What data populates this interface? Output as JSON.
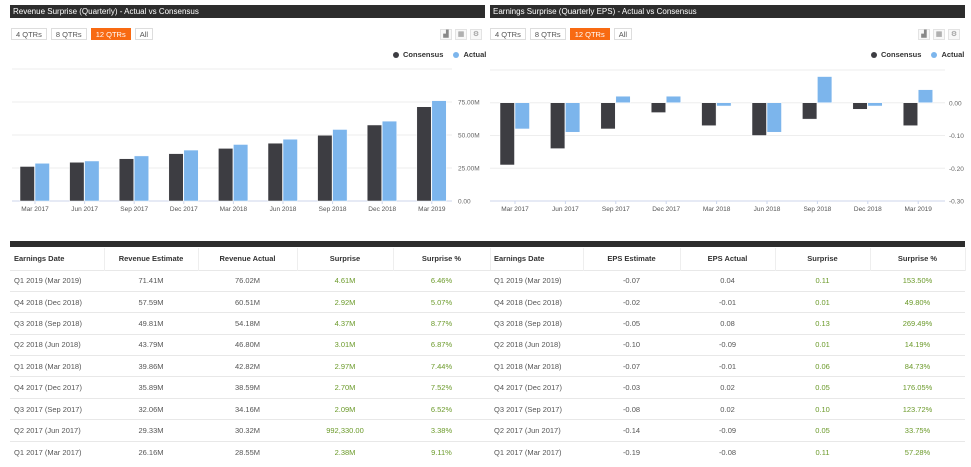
{
  "range_buttons": [
    "4 QTRs",
    "8 QTRs",
    "12 QTRs",
    "All"
  ],
  "active_range": "12 QTRs",
  "colors": {
    "consensus": "#3d3d42",
    "actual": "#7cb5ec",
    "accent": "#f86a12",
    "positive": "#6b9a2a"
  },
  "legend": {
    "consensus": "Consensus",
    "actual": "Actual"
  },
  "tools": [
    "chart-icon",
    "table-icon",
    "gear-icon"
  ],
  "chart_data": [
    {
      "type": "bar",
      "title": "Revenue Surprise (Quarterly) - Actual vs Consensus",
      "categories": [
        "Mar 2017",
        "Jun 2017",
        "Sep 2017",
        "Dec 2017",
        "Mar 2018",
        "Jun 2018",
        "Sep 2018",
        "Dec 2018",
        "Mar 2019"
      ],
      "series": [
        {
          "name": "Consensus",
          "values": [
            26.16,
            29.33,
            32.06,
            35.89,
            39.86,
            43.79,
            49.81,
            57.59,
            71.41
          ]
        },
        {
          "name": "Actual",
          "values": [
            28.55,
            30.32,
            34.16,
            38.59,
            42.82,
            46.8,
            54.18,
            60.51,
            76.02
          ]
        }
      ],
      "yticks": [
        "0.00",
        "25.00M",
        "50.00M",
        "75.00M"
      ],
      "ytick_values": [
        0,
        25,
        50,
        75
      ],
      "ylim": [
        0,
        100
      ],
      "yunit": "M"
    },
    {
      "type": "bar",
      "title": "Earnings Surprise (Quarterly EPS) - Actual vs Consensus",
      "categories": [
        "Mar 2017",
        "Jun 2017",
        "Sep 2017",
        "Dec 2017",
        "Mar 2018",
        "Jun 2018",
        "Sep 2018",
        "Dec 2018",
        "Mar 2019"
      ],
      "series": [
        {
          "name": "Consensus",
          "values": [
            -0.19,
            -0.14,
            -0.08,
            -0.03,
            -0.07,
            -0.1,
            -0.05,
            -0.02,
            -0.07
          ]
        },
        {
          "name": "Actual",
          "values": [
            -0.08,
            -0.09,
            0.02,
            0.02,
            -0.01,
            -0.09,
            0.08,
            -0.01,
            0.04
          ]
        }
      ],
      "yticks": [
        "0.00",
        "-0.10",
        "-0.20",
        "-0.30"
      ],
      "ytick_values": [
        0,
        -0.1,
        -0.2,
        -0.3
      ],
      "ylim": [
        -0.3,
        0.1
      ]
    }
  ],
  "revenue_table": {
    "headers": [
      "Earnings Date",
      "Revenue Estimate",
      "Revenue Actual",
      "Surprise",
      "Surprise %"
    ],
    "rows": [
      [
        "Q1 2019 (Mar 2019)",
        "71.41M",
        "76.02M",
        "4.61M",
        "6.46%"
      ],
      [
        "Q4 2018 (Dec 2018)",
        "57.59M",
        "60.51M",
        "2.92M",
        "5.07%"
      ],
      [
        "Q3 2018 (Sep 2018)",
        "49.81M",
        "54.18M",
        "4.37M",
        "8.77%"
      ],
      [
        "Q2 2018 (Jun 2018)",
        "43.79M",
        "46.80M",
        "3.01M",
        "6.87%"
      ],
      [
        "Q1 2018 (Mar 2018)",
        "39.86M",
        "42.82M",
        "2.97M",
        "7.44%"
      ],
      [
        "Q4 2017 (Dec 2017)",
        "35.89M",
        "38.59M",
        "2.70M",
        "7.52%"
      ],
      [
        "Q3 2017 (Sep 2017)",
        "32.06M",
        "34.16M",
        "2.09M",
        "6.52%"
      ],
      [
        "Q2 2017 (Jun 2017)",
        "29.33M",
        "30.32M",
        "992,330.00",
        "3.38%"
      ],
      [
        "Q1 2017 (Mar 2017)",
        "26.16M",
        "28.55M",
        "2.38M",
        "9.11%"
      ]
    ]
  },
  "eps_table": {
    "headers": [
      "Earnings Date",
      "EPS Estimate",
      "EPS Actual",
      "Surprise",
      "Surprise %"
    ],
    "rows": [
      [
        "Q1 2019 (Mar 2019)",
        "-0.07",
        "0.04",
        "0.11",
        "153.50%"
      ],
      [
        "Q4 2018 (Dec 2018)",
        "-0.02",
        "-0.01",
        "0.01",
        "49.80%"
      ],
      [
        "Q3 2018 (Sep 2018)",
        "-0.05",
        "0.08",
        "0.13",
        "269.49%"
      ],
      [
        "Q2 2018 (Jun 2018)",
        "-0.10",
        "-0.09",
        "0.01",
        "14.19%"
      ],
      [
        "Q1 2018 (Mar 2018)",
        "-0.07",
        "-0.01",
        "0.06",
        "84.73%"
      ],
      [
        "Q4 2017 (Dec 2017)",
        "-0.03",
        "0.02",
        "0.05",
        "176.05%"
      ],
      [
        "Q3 2017 (Sep 2017)",
        "-0.08",
        "0.02",
        "0.10",
        "123.72%"
      ],
      [
        "Q2 2017 (Jun 2017)",
        "-0.14",
        "-0.09",
        "0.05",
        "33.75%"
      ],
      [
        "Q1 2017 (Mar 2017)",
        "-0.19",
        "-0.08",
        "0.11",
        "57.28%"
      ]
    ]
  }
}
